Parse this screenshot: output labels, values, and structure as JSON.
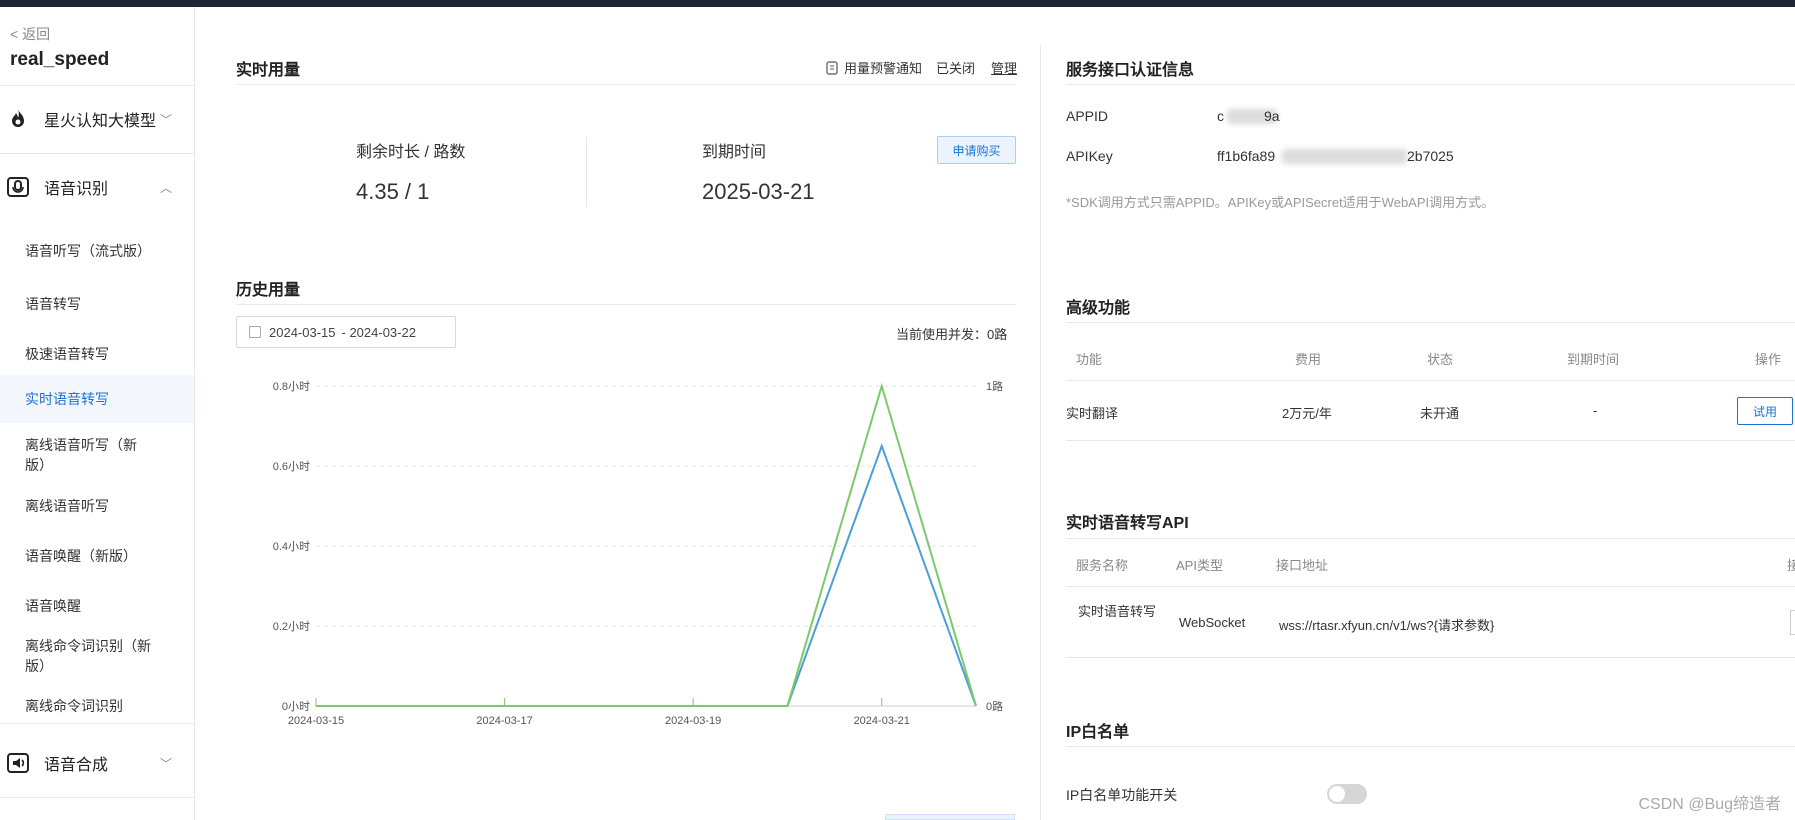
{
  "sidebar": {
    "back": "< 返回",
    "app_name": "real_speed",
    "categories": [
      {
        "label": "星火认知大模型",
        "chevron": "﹀"
      },
      {
        "label": "语音识别",
        "chevron": "︿"
      },
      {
        "label": "语音合成",
        "chevron": "﹀"
      }
    ],
    "items": [
      "语音听写（流式版）",
      "语音转写",
      "极速语音转写",
      "实时语音转写",
      "离线语音听写（新版）",
      "离线语音听写",
      "语音唤醒（新版）",
      "语音唤醒",
      "离线命令词识别（新版）",
      "离线命令词识别"
    ]
  },
  "realtime": {
    "title": "实时用量",
    "alert_label": "用量预警通知",
    "alert_status": "已关闭",
    "manage": "管理",
    "remain_label": "剩余时长 / 路数",
    "remain_value": "4.35 / 1",
    "expire_label": "到期时间",
    "expire_value": "2025-03-21",
    "buy_button": "申请购买"
  },
  "history": {
    "title": "历史用量",
    "date_start": "2024-03-15",
    "date_end": "- 2024-03-22",
    "concurrency": "当前使用并发：0路"
  },
  "chart_data": {
    "type": "line",
    "x": [
      "2024-03-15",
      "2024-03-16",
      "2024-03-17",
      "2024-03-18",
      "2024-03-19",
      "2024-03-20",
      "2024-03-21",
      "2024-03-22"
    ],
    "x_tick_labels": [
      "2024-03-15",
      "2024-03-17",
      "2024-03-19",
      "2024-03-21"
    ],
    "y_left_ticks": [
      "0小时",
      "0.2小时",
      "0.4小时",
      "0.6小时",
      "0.8小时"
    ],
    "y_left_range": [
      0,
      0.8
    ],
    "y_right_ticks": [
      "0路",
      "1路"
    ],
    "y_right_range": [
      0,
      1
    ],
    "series": [
      {
        "axis": "left",
        "color": "#4a9fdb",
        "values": [
          0,
          0,
          0,
          0,
          0,
          0,
          0.65,
          0
        ]
      },
      {
        "axis": "right",
        "color": "#7cc96a",
        "values": [
          0,
          0,
          0,
          0,
          0,
          0,
          1,
          0
        ]
      }
    ],
    "grid": "dashed-horizontal"
  },
  "auth": {
    "title": "服务接口认证信息",
    "appid_label": "APPID",
    "appid_prefix": "c",
    "appid_suffix": "9a",
    "apikey_label": "APIKey",
    "apikey_prefix": "ff1b6fa89",
    "apikey_suffix": "2b7025",
    "note": "*SDK调用方式只需APPID。APIKey或APISecret适用于WebAPI调用方式。"
  },
  "advanced": {
    "title": "高级功能",
    "headers": [
      "功能",
      "费用",
      "状态",
      "到期时间",
      "操作"
    ],
    "row": {
      "feature": "实时翻译",
      "fee": "2万元/年",
      "status": "未开通",
      "expire": "-",
      "action": "试用"
    }
  },
  "api": {
    "title": "实时语音转写API",
    "headers": [
      "服务名称",
      "API类型",
      "接口地址",
      "接"
    ],
    "row": {
      "name": "实时语音转写",
      "type": "WebSocket",
      "url": "wss://rtasr.xfyun.cn/v1/ws?{请求参数}"
    }
  },
  "whitelist": {
    "title": "IP白名单",
    "switch_label": "IP白名单功能开关"
  },
  "watermark": "CSDN @Bug缔造者",
  "colors": {
    "accent": "#1a74d6",
    "line_blue": "#4a9fdb",
    "line_green": "#7cc96a"
  }
}
